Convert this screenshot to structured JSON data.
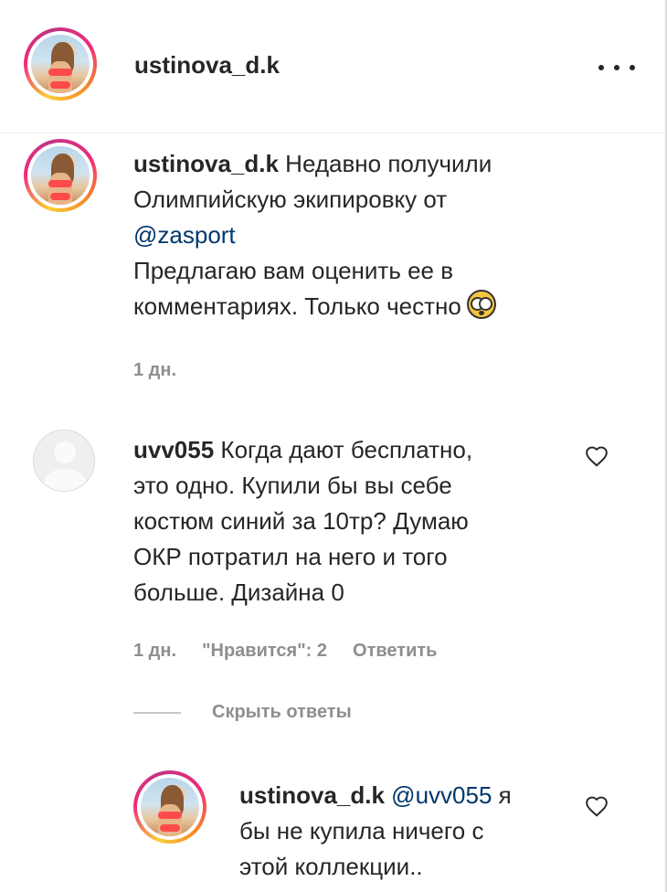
{
  "header": {
    "username": "ustinova_d.k"
  },
  "caption": {
    "username": "ustinova_d.k",
    "line1": "Недавно получили",
    "line2": "Олимпийскую экипировку от",
    "mention": "@zasport",
    "line4": "Предлагаю вам оценить ее в",
    "line5": "комментариях. Только честно",
    "emoji": "flushed-face-icon",
    "time": "1 дн."
  },
  "comment1": {
    "username": "uvv055",
    "line1": "Когда дают бесплатно,",
    "line2": "это одно. Купили бы вы себе",
    "line3": "костюм синий за 10тр? Думаю",
    "line4": "ОКР потратил на него и того",
    "line5": "больше. Дизайна 0",
    "time": "1 дн.",
    "likes": "\"Нравится\": 2",
    "reply": "Ответить"
  },
  "replies_toggle": {
    "label": "Скрыть ответы"
  },
  "reply1": {
    "username": "ustinova_d.k",
    "mention": "@uvv055",
    "line1_rest": "я",
    "line2": "бы не купила ничего с",
    "line3": "этой коллекции.."
  },
  "colors": {
    "text": "#262626",
    "secondary": "#8e8e8e",
    "mention": "#00376b"
  }
}
